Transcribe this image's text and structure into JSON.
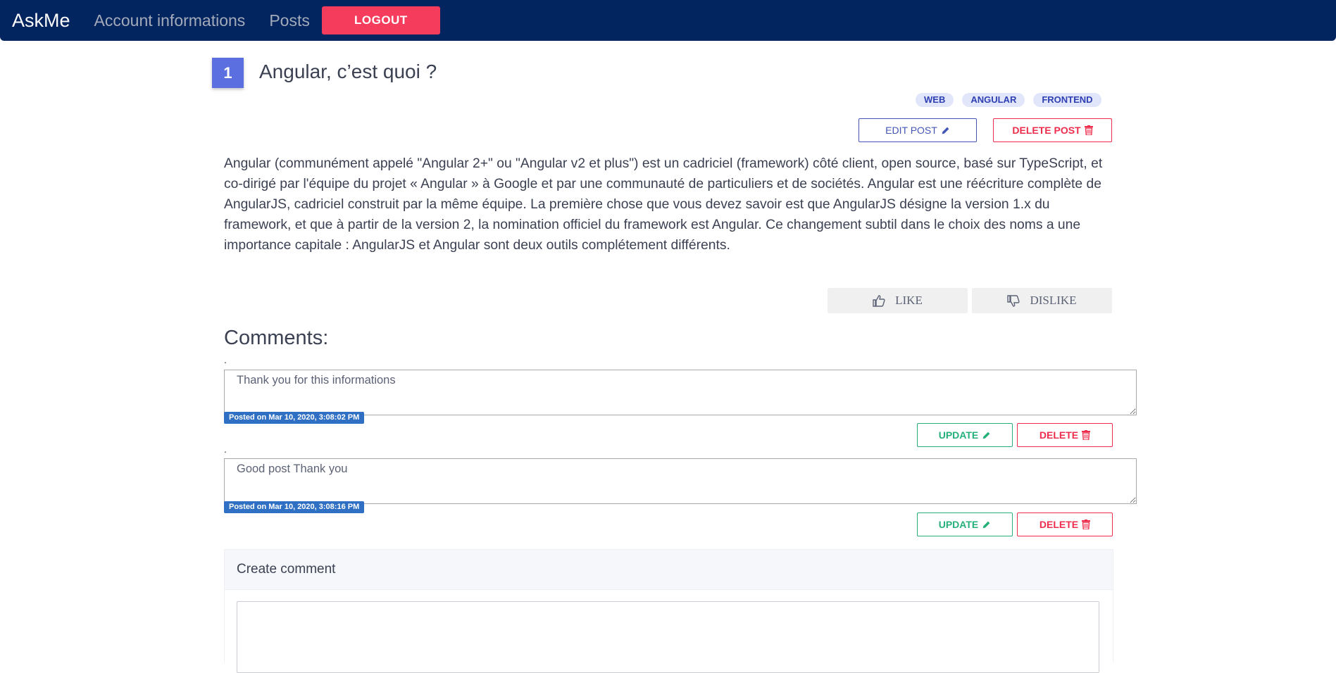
{
  "navbar": {
    "brand": "AskMe",
    "links": [
      "Account informations",
      "Posts"
    ],
    "logout_label": "LOGOUT"
  },
  "post": {
    "number": "1",
    "title": "Angular, c’est quoi ?",
    "tags": [
      "WEB",
      "ANGULAR",
      "FRONTEND"
    ],
    "edit_label": "EDIT POST",
    "delete_label": "DELETE POST",
    "content": "Angular (communément appelé \"Angular 2+\" ou \"Angular v2 et plus\") est un cadriciel (framework) côté client, open source, basé sur TypeScript, et co-dirigé par l'équipe du projet « Angular » à Google et par une communauté de particuliers et de sociétés. Angular est une réécriture complète de AngularJS, cadriciel construit par la même équipe. La première chose que vous devez savoir est que AngularJS désigne la version 1.x du framework, et que à partir de la version 2, la nomination officiel du framework est Angular. Ce changement subtil dans le choix des noms a une importance capitale : AngularJS et Angular sont deux outils complétement différents."
  },
  "votes": {
    "like_label": "LIKE",
    "dislike_label": "DISLIKE"
  },
  "comments": {
    "title": "Comments:",
    "dot": ".",
    "items": [
      {
        "text": "Thank you for this informations",
        "posted": "Posted on Mar 10, 2020, 3:08:02 PM"
      },
      {
        "text": "Good post Thank you",
        "posted": "Posted on Mar 10, 2020, 3:08:16 PM"
      }
    ],
    "update_label": "UPDATE",
    "delete_label": "DELETE"
  },
  "create_comment": {
    "header": "Create comment"
  },
  "colors": {
    "navbar": "#02245f",
    "logout": "#f53c5c",
    "post_number": "#5c6fe0",
    "edit": "#4455b5",
    "delete": "#ee2d4c",
    "update": "#25b07a",
    "badge": "#2f70c4"
  }
}
